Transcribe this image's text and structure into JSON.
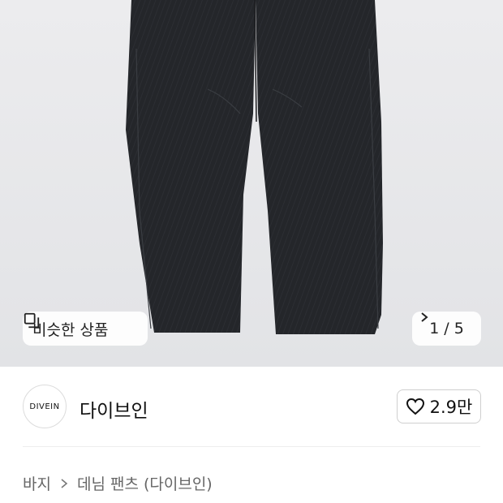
{
  "gallery": {
    "similar_label": "비슷한 상품",
    "current_index": "1",
    "separator": "/",
    "total": "5"
  },
  "brand": {
    "logo_text": "DIVEIN",
    "name": "다이브인",
    "like_count": "2.9만"
  },
  "breadcrumb": {
    "category": "바지",
    "subcategory": "데님 팬츠 (다이브인)"
  },
  "colors": {
    "hero_background": "#e6e7e9",
    "pants": "#232528",
    "text_primary": "#111111",
    "text_secondary": "#666666"
  },
  "icons": [
    "similar-items-icon",
    "chevron-right-icon",
    "heart-icon"
  ]
}
